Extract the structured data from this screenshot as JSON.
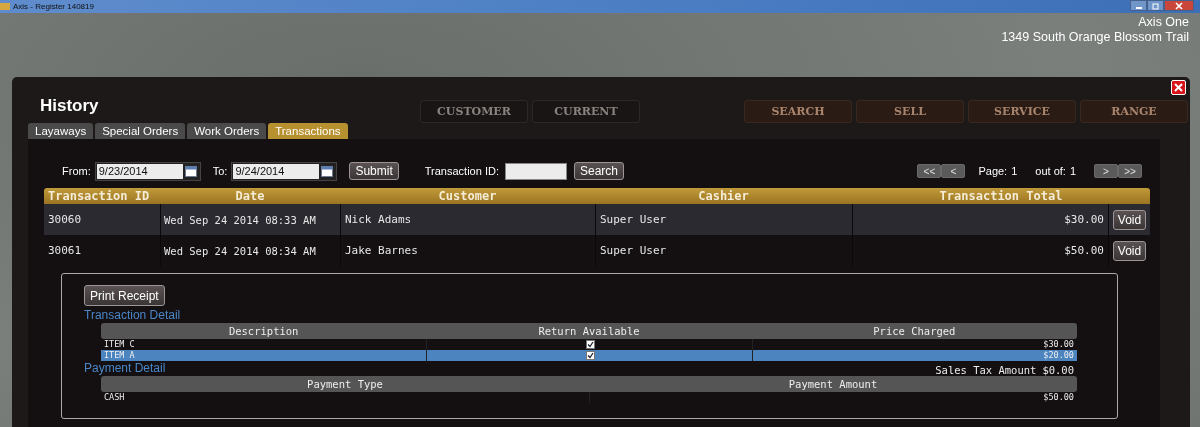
{
  "window": {
    "title": "Axis - Register  140819"
  },
  "store": {
    "name": "Axis One",
    "address": "1349 South Orange Blossom Trail"
  },
  "background_nav": [
    {
      "label": "CUSTOMER",
      "kind": "dark"
    },
    {
      "label": "CURRENT",
      "kind": "dark"
    },
    {
      "label": "SEARCH",
      "kind": "warm"
    },
    {
      "label": "SELL",
      "kind": "warm"
    },
    {
      "label": "SERVICE",
      "kind": "warm"
    },
    {
      "label": "RANGE",
      "kind": "warm"
    }
  ],
  "dialog": {
    "title": "History"
  },
  "tabs": [
    {
      "label": "Layaways",
      "selected": false
    },
    {
      "label": "Special Orders",
      "selected": false
    },
    {
      "label": "Work Orders",
      "selected": false
    },
    {
      "label": "Transactions",
      "selected": true
    }
  ],
  "filter": {
    "from_label": "From:",
    "from_value": "9/23/2014",
    "to_label": "To:",
    "to_value": "9/24/2014",
    "submit": "Submit",
    "transaction_id_label": "Transaction ID:",
    "search": "Search"
  },
  "pager": {
    "first": "<<",
    "prev": "<",
    "page_label": "Page:",
    "page": "1",
    "out_of_label": "out of:",
    "out_of": "1",
    "next": ">",
    "last": ">>"
  },
  "table": {
    "columns": [
      "Transaction ID",
      "Date",
      "Customer",
      "Cashier",
      "Transaction Total"
    ],
    "rows": [
      {
        "id": "30060",
        "date": "Wed Sep 24 2014 08:33 AM",
        "customer": "Nick Adams",
        "cashier": "Super User",
        "total": "$30.00",
        "action": "Void",
        "selected": true
      },
      {
        "id": "30061",
        "date": "Wed Sep 24 2014 08:34 AM",
        "customer": "Jake Barnes",
        "cashier": "Super User",
        "total": "$50.00",
        "action": "Void",
        "selected": false
      }
    ]
  },
  "detail": {
    "print_button": "Print Receipt",
    "transaction_title": "Transaction Detail",
    "item_columns": [
      "Description",
      "Return Available",
      "Price Charged"
    ],
    "items": [
      {
        "description": "ITEM C",
        "return_available": true,
        "price": "$30.00",
        "selected": false
      },
      {
        "description": "ITEM A",
        "return_available": true,
        "price": "$20.00",
        "selected": true
      }
    ],
    "sales_tax_label": "Sales Tax Amount",
    "sales_tax": "$0.00",
    "payment_title": "Payment Detail",
    "payment_columns": [
      "Payment Type",
      "Payment Amount"
    ],
    "payments": [
      {
        "type": "CASH",
        "amount": "$50.00"
      }
    ]
  }
}
